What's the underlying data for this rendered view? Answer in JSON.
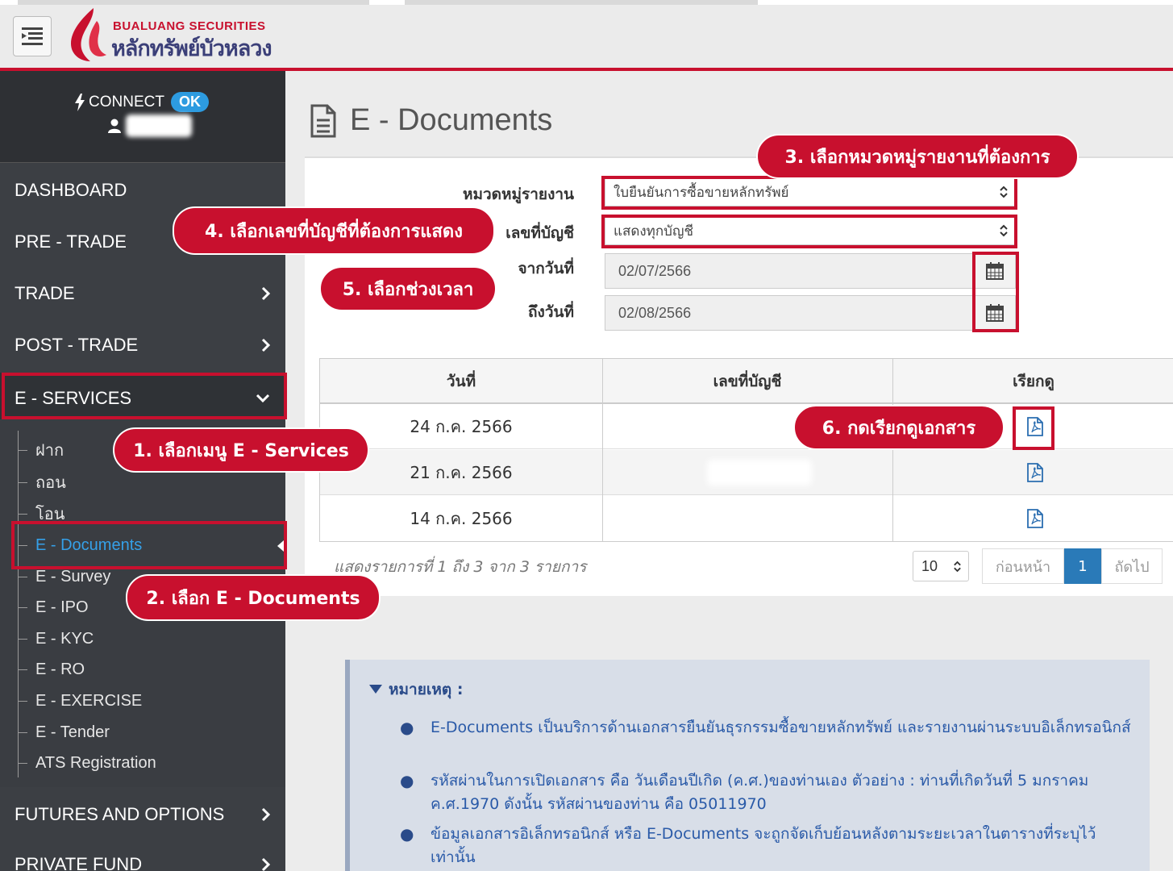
{
  "brand": {
    "en": "BUALUANG SECURITIES",
    "th": "หลักทรัพย์บัวหลวง"
  },
  "status": {
    "connect_label": "CONNECT",
    "ok_label": "OK"
  },
  "sidebar": {
    "items": [
      {
        "label": "DASHBOARD"
      },
      {
        "label": "PRE - TRADE"
      },
      {
        "label": "TRADE"
      },
      {
        "label": "POST - TRADE"
      },
      {
        "label": "E - SERVICES"
      },
      {
        "label": "FUTURES AND OPTIONS"
      },
      {
        "label": "PRIVATE FUND"
      }
    ],
    "sub_items": [
      {
        "label": "ฝาก"
      },
      {
        "label": "ถอน"
      },
      {
        "label": "โอน"
      },
      {
        "label": "E - Documents"
      },
      {
        "label": "E - Survey"
      },
      {
        "label": "E - IPO"
      },
      {
        "label": "E - KYC"
      },
      {
        "label": "E - RO"
      },
      {
        "label": "E - EXERCISE"
      },
      {
        "label": "E - Tender"
      },
      {
        "label": "ATS Registration"
      }
    ]
  },
  "page": {
    "title": "E - Documents"
  },
  "form": {
    "category_label": "หมวดหมู่รายงาน",
    "category_value": "ใบยืนยันการซื้อขายหลักทรัพย์",
    "account_label": "เลขที่บัญชี",
    "account_value": "แสดงทุกบัญชี",
    "from_label": "จากวันที่",
    "from_value": "02/07/2566",
    "to_label": "ถึงวันที่",
    "to_value": "02/08/2566"
  },
  "table": {
    "headers": [
      "วันที่",
      "เลขที่บัญชี",
      "เรียกดู"
    ],
    "rows": [
      {
        "date": "24 ก.ค. 2566"
      },
      {
        "date": "21 ก.ค. 2566"
      },
      {
        "date": "14 ก.ค. 2566"
      }
    ]
  },
  "pagination": {
    "info": "แสดงรายการที่ 1 ถึง 3 จาก 3 รายการ",
    "page_size": "10",
    "prev_label": "ก่อนหน้า",
    "current_page": "1",
    "next_label": "ถัดไป"
  },
  "notes": {
    "title": "หมายเหตุ :",
    "items": [
      "E-Documents เป็นบริการด้านเอกสารยืนยันธุรกรรมซื้อขายหลักทรัพย์ และรายงานผ่านระบบอิเล็กทรอนิกส์",
      "รหัสผ่านในการเปิดเอกสาร คือ วันเดือนปีเกิด (ค.ศ.)ของท่านเอง ตัวอย่าง : ท่านที่เกิดวันที่ 5 มกราคม ค.ศ.1970 ดังนั้น รหัสผ่านของท่าน คือ 05011970",
      "ข้อมูลเอกสารอิเล็กทรอนิกส์ หรือ E-Documents จะถูกจัดเก็บย้อนหลังตามระยะเวลาในตารางที่ระบุไว้เท่านั้น"
    ]
  },
  "annotations": {
    "step1": "1. เลือกเมนู E - Services",
    "step2": "2. เลือก E - Documents",
    "step3": "3. เลือกหมวดหมู่รายงานที่ต้องการ",
    "step4": "4. เลือกเลขที่บัญชีที่ต้องการแสดง",
    "step5": "5. เลือกช่วงเวลา",
    "step6": "6. กดเรียกดูเอกสาร"
  },
  "colors": {
    "brand_red": "#c8102e",
    "sidebar_bg": "#3c3f44",
    "active_link": "#35a0e8"
  }
}
